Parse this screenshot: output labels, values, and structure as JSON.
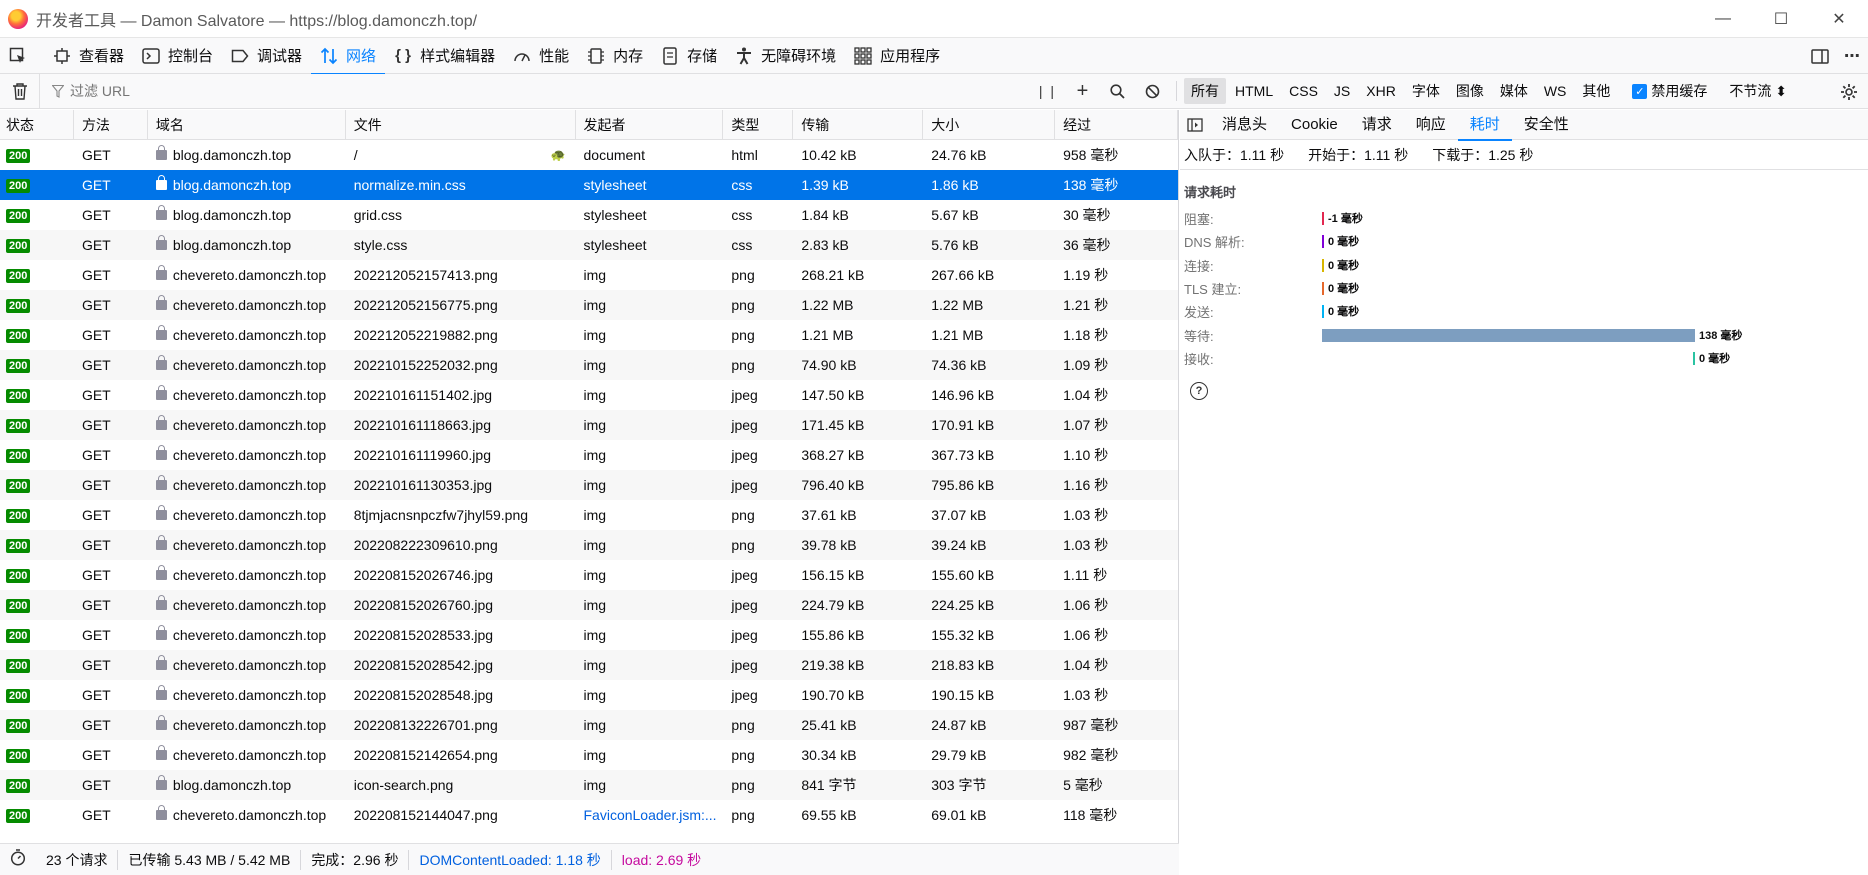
{
  "window": {
    "title": "开发者工具 — Damon Salvatore — https://blog.damonczh.top/",
    "minimize": "—",
    "maximize": "☐",
    "close": "✕"
  },
  "tools": [
    {
      "label": "",
      "icon": "picker-icon"
    },
    {
      "label": "查看器",
      "icon": "inspector-icon"
    },
    {
      "label": "控制台",
      "icon": "console-icon"
    },
    {
      "label": "调试器",
      "icon": "debugger-icon"
    },
    {
      "label": "网络",
      "icon": "network-icon"
    },
    {
      "label": "样式编辑器",
      "icon": "style-editor-icon"
    },
    {
      "label": "性能",
      "icon": "performance-icon"
    },
    {
      "label": "内存",
      "icon": "memory-icon"
    },
    {
      "label": "存储",
      "icon": "storage-icon"
    },
    {
      "label": "无障碍环境",
      "icon": "accessibility-icon"
    },
    {
      "label": "应用程序",
      "icon": "application-icon"
    }
  ],
  "filter": {
    "placeholder": "过滤 URL",
    "types": [
      "所有",
      "HTML",
      "CSS",
      "JS",
      "XHR",
      "字体",
      "图像",
      "媒体",
      "WS",
      "其他"
    ],
    "active_type": "所有",
    "disable_cache_label": "禁用缓存",
    "throttle_label": "不节流 ⬍"
  },
  "table": {
    "headers": [
      "状态",
      "方法",
      "域名",
      "文件",
      "发起者",
      "类型",
      "传输",
      "大小",
      "经过"
    ],
    "rows": [
      {
        "status": "200",
        "method": "GET",
        "domain": "blog.damonczh.top",
        "file": "/",
        "initiator": "document",
        "type": "html",
        "transferred": "10.42 kB",
        "size": "24.76 kB",
        "time": "958 毫秒"
      },
      {
        "status": "200",
        "method": "GET",
        "domain": "blog.damonczh.top",
        "file": "normalize.min.css",
        "initiator": "stylesheet",
        "type": "css",
        "transferred": "1.39 kB",
        "size": "1.86 kB",
        "time": "138 毫秒"
      },
      {
        "status": "200",
        "method": "GET",
        "domain": "blog.damonczh.top",
        "file": "grid.css",
        "initiator": "stylesheet",
        "type": "css",
        "transferred": "1.84 kB",
        "size": "5.67 kB",
        "time": "30 毫秒"
      },
      {
        "status": "200",
        "method": "GET",
        "domain": "blog.damonczh.top",
        "file": "style.css",
        "initiator": "stylesheet",
        "type": "css",
        "transferred": "2.83 kB",
        "size": "5.76 kB",
        "time": "36 毫秒"
      },
      {
        "status": "200",
        "method": "GET",
        "domain": "chevereto.damonczh.top",
        "file": "202212052157413.png",
        "initiator": "img",
        "type": "png",
        "transferred": "268.21 kB",
        "size": "267.66 kB",
        "time": "1.19 秒"
      },
      {
        "status": "200",
        "method": "GET",
        "domain": "chevereto.damonczh.top",
        "file": "202212052156775.png",
        "initiator": "img",
        "type": "png",
        "transferred": "1.22 MB",
        "size": "1.22 MB",
        "time": "1.21 秒"
      },
      {
        "status": "200",
        "method": "GET",
        "domain": "chevereto.damonczh.top",
        "file": "202212052219882.png",
        "initiator": "img",
        "type": "png",
        "transferred": "1.21 MB",
        "size": "1.21 MB",
        "time": "1.18 秒"
      },
      {
        "status": "200",
        "method": "GET",
        "domain": "chevereto.damonczh.top",
        "file": "202210152252032.png",
        "initiator": "img",
        "type": "png",
        "transferred": "74.90 kB",
        "size": "74.36 kB",
        "time": "1.09 秒"
      },
      {
        "status": "200",
        "method": "GET",
        "domain": "chevereto.damonczh.top",
        "file": "202210161151402.jpg",
        "initiator": "img",
        "type": "jpeg",
        "transferred": "147.50 kB",
        "size": "146.96 kB",
        "time": "1.04 秒"
      },
      {
        "status": "200",
        "method": "GET",
        "domain": "chevereto.damonczh.top",
        "file": "202210161118663.jpg",
        "initiator": "img",
        "type": "jpeg",
        "transferred": "171.45 kB",
        "size": "170.91 kB",
        "time": "1.07 秒"
      },
      {
        "status": "200",
        "method": "GET",
        "domain": "chevereto.damonczh.top",
        "file": "202210161119960.jpg",
        "initiator": "img",
        "type": "jpeg",
        "transferred": "368.27 kB",
        "size": "367.73 kB",
        "time": "1.10 秒"
      },
      {
        "status": "200",
        "method": "GET",
        "domain": "chevereto.damonczh.top",
        "file": "202210161130353.jpg",
        "initiator": "img",
        "type": "jpeg",
        "transferred": "796.40 kB",
        "size": "795.86 kB",
        "time": "1.16 秒"
      },
      {
        "status": "200",
        "method": "GET",
        "domain": "chevereto.damonczh.top",
        "file": "8tjmjacnsnpczfw7jhyl59.png",
        "initiator": "img",
        "type": "png",
        "transferred": "37.61 kB",
        "size": "37.07 kB",
        "time": "1.03 秒"
      },
      {
        "status": "200",
        "method": "GET",
        "domain": "chevereto.damonczh.top",
        "file": "202208222309610.png",
        "initiator": "img",
        "type": "png",
        "transferred": "39.78 kB",
        "size": "39.24 kB",
        "time": "1.03 秒"
      },
      {
        "status": "200",
        "method": "GET",
        "domain": "chevereto.damonczh.top",
        "file": "202208152026746.jpg",
        "initiator": "img",
        "type": "jpeg",
        "transferred": "156.15 kB",
        "size": "155.60 kB",
        "time": "1.11 秒"
      },
      {
        "status": "200",
        "method": "GET",
        "domain": "chevereto.damonczh.top",
        "file": "202208152026760.jpg",
        "initiator": "img",
        "type": "jpeg",
        "transferred": "224.79 kB",
        "size": "224.25 kB",
        "time": "1.06 秒"
      },
      {
        "status": "200",
        "method": "GET",
        "domain": "chevereto.damonczh.top",
        "file": "202208152028533.jpg",
        "initiator": "img",
        "type": "jpeg",
        "transferred": "155.86 kB",
        "size": "155.32 kB",
        "time": "1.06 秒"
      },
      {
        "status": "200",
        "method": "GET",
        "domain": "chevereto.damonczh.top",
        "file": "202208152028542.jpg",
        "initiator": "img",
        "type": "jpeg",
        "transferred": "219.38 kB",
        "size": "218.83 kB",
        "time": "1.04 秒"
      },
      {
        "status": "200",
        "method": "GET",
        "domain": "chevereto.damonczh.top",
        "file": "202208152028548.jpg",
        "initiator": "img",
        "type": "jpeg",
        "transferred": "190.70 kB",
        "size": "190.15 kB",
        "time": "1.03 秒"
      },
      {
        "status": "200",
        "method": "GET",
        "domain": "chevereto.damonczh.top",
        "file": "202208132226701.png",
        "initiator": "img",
        "type": "png",
        "transferred": "25.41 kB",
        "size": "24.87 kB",
        "time": "987 毫秒"
      },
      {
        "status": "200",
        "method": "GET",
        "domain": "chevereto.damonczh.top",
        "file": "202208152142654.png",
        "initiator": "img",
        "type": "png",
        "transferred": "30.34 kB",
        "size": "29.79 kB",
        "time": "982 毫秒"
      },
      {
        "status": "200",
        "method": "GET",
        "domain": "blog.damonczh.top",
        "file": "icon-search.png",
        "initiator": "img",
        "type": "png",
        "transferred": "841 字节",
        "size": "303 字节",
        "time": "5 毫秒"
      },
      {
        "status": "200",
        "method": "GET",
        "domain": "chevereto.damonczh.top",
        "file": "202208152144047.png",
        "initiator": "FaviconLoader.jsm:...",
        "type": "png",
        "transferred": "69.55 kB",
        "size": "69.01 kB",
        "time": "118 毫秒"
      }
    ]
  },
  "status_bar": {
    "requests": "23 个请求",
    "transferred": "已传输 5.43 MB / 5.42 MB",
    "finish": "完成：2.96 秒",
    "dom_content_loaded": "DOMContentLoaded: 1.18 秒",
    "load": "load: 2.69 秒"
  },
  "details": {
    "tabs": [
      "消息头",
      "Cookie",
      "请求",
      "响应",
      "耗时",
      "安全性"
    ],
    "selected_tab": "耗时",
    "queued": "入队于：1.11 秒",
    "started": "开始于：1.11 秒",
    "downloaded": "下载于：1.25 秒",
    "timing_title": "请求耗时",
    "timings": [
      {
        "label": "阻塞:",
        "value": "-1 毫秒",
        "color": "#e22850",
        "fraction": 0.0
      },
      {
        "label": "DNS 解析:",
        "value": "0 毫秒",
        "color": "#8000d7",
        "fraction": 0.0
      },
      {
        "label": "连接:",
        "value": "0 毫秒",
        "color": "#d7b600",
        "fraction": 0.0
      },
      {
        "label": "TLS 建立:",
        "value": "0 毫秒",
        "color": "#e5682c",
        "fraction": 0.0
      },
      {
        "label": "发送:",
        "value": "0 毫秒",
        "color": "#00b3f4",
        "fraction": 0.0
      },
      {
        "label": "等待:",
        "value": "138 毫秒",
        "color": "#7d9ec0",
        "fraction": 1.0
      },
      {
        "label": "接收:",
        "value": "0 毫秒",
        "color": "#2ac3a2",
        "fraction": 0.0
      }
    ]
  },
  "colors": {
    "accent": "#0a84ff",
    "selected_row": "#0074e8",
    "status_ok": "#058b00"
  }
}
